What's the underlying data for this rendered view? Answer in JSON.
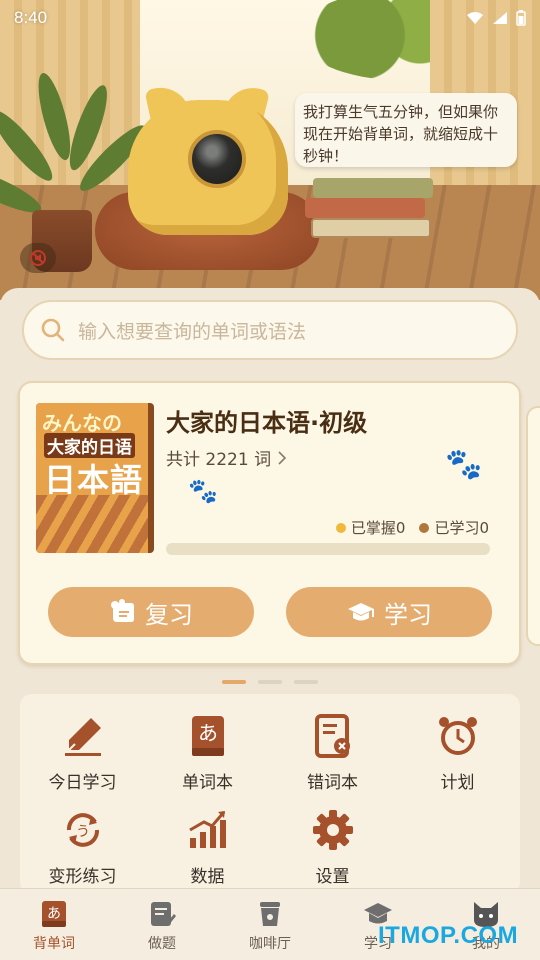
{
  "status_bar": {
    "time": "8:40"
  },
  "hero": {
    "speech_bubble": "我打算生气五分钟，但如果你现在开始背单词，就缩短成十秒钟！"
  },
  "search": {
    "placeholder": "输入想要查询的单词或语法"
  },
  "book_card": {
    "cover_line1": "みんなの",
    "cover_line2": "大家的日语",
    "cover_line3": "日本語",
    "title": "大家的日本语·初级",
    "word_count": "共计 2221 词",
    "mastered": "已掌握0",
    "learned": "已学习0",
    "progress": 0,
    "review_label": "复习",
    "study_label": "学习",
    "colors": {
      "mastered_dot": "#f0b93a",
      "learned_dot": "#b07838"
    }
  },
  "pager": {
    "count": 3,
    "active": 0
  },
  "features": [
    {
      "label": "今日学习",
      "icon": "pen-icon"
    },
    {
      "label": "单词本",
      "icon": "wordbook-icon"
    },
    {
      "label": "错词本",
      "icon": "error-book-icon"
    },
    {
      "label": "计划",
      "icon": "alarm-clock-icon"
    },
    {
      "label": "变形练习",
      "icon": "conjugation-icon"
    },
    {
      "label": "数据",
      "icon": "chart-icon"
    },
    {
      "label": "设置",
      "icon": "gear-icon"
    }
  ],
  "bottom_nav": [
    {
      "label": "背单词",
      "icon": "kana-a-icon",
      "active": true
    },
    {
      "label": "做题",
      "icon": "quiz-icon",
      "active": false
    },
    {
      "label": "咖啡厅",
      "icon": "coffee-icon",
      "active": false
    },
    {
      "label": "学习",
      "icon": "graduation-cap-icon",
      "active": false
    },
    {
      "label": "我的",
      "icon": "cat-face-icon",
      "active": false
    }
  ],
  "watermark": "ITMOP.COM",
  "colors": {
    "accent": "#e4ad6f",
    "icon_brown": "#a5512c",
    "background": "#efe6d6"
  }
}
